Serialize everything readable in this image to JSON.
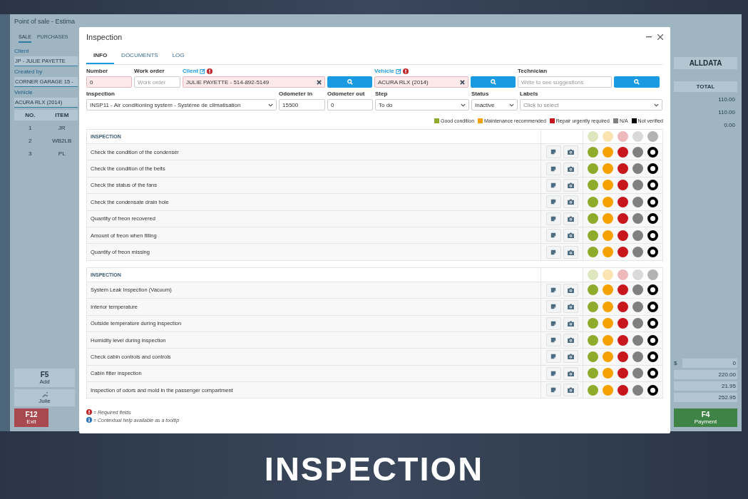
{
  "background_app": {
    "title": "Point of sale - Estima",
    "tabs": [
      {
        "label": "SALE",
        "selected": true
      },
      {
        "label": "PURCHASES",
        "selected": false
      }
    ],
    "fields": [
      {
        "label": "Client",
        "value": "JP - JULIE PAYETTE"
      },
      {
        "label": "Created by",
        "value": "CORNER GARAGE 15 -"
      },
      {
        "label": "Vehicle",
        "value": "ACURA RLX (2014)"
      }
    ],
    "table": {
      "columns": [
        "NO.",
        "ITEM"
      ],
      "rows": [
        [
          "1",
          "JR"
        ],
        [
          "2",
          "WB2LB"
        ],
        [
          "3",
          "PL"
        ]
      ]
    },
    "left_buttons": [
      {
        "key": "F5",
        "label": "Add"
      },
      {
        "label": "Julie"
      }
    ],
    "exit_button": {
      "key": "F12",
      "label": "Exit"
    },
    "right_logo": "ALLDATA",
    "total_column": "TOTAL",
    "totals": [
      "110.00",
      "110.00",
      "0.00"
    ],
    "discount": {
      "symbol": "$",
      "value": "0"
    },
    "summary": [
      "220.00",
      "21.95",
      "252.95"
    ],
    "payment_button": {
      "key": "F4",
      "label": "Payment"
    }
  },
  "dialog": {
    "title": "Inspection",
    "tabs": [
      {
        "label": "INFO",
        "selected": true
      },
      {
        "label": "DOCUMENTS",
        "selected": false
      },
      {
        "label": "LOG",
        "selected": false
      }
    ],
    "row_1": [
      {
        "kind": "text",
        "label": "Number",
        "value": "0",
        "invalid": true
      },
      {
        "kind": "text",
        "label": "Work order",
        "placeholder": "Work order",
        "invalid": false
      },
      {
        "kind": "lookup",
        "label": "Client",
        "value": "JULIE PAYETTE - 514-892-5149",
        "invalid": true,
        "required": true
      },
      {
        "kind": "search_button"
      },
      {
        "kind": "lookup",
        "label": "Vehicle",
        "value": "ACURA RLX (2014)",
        "invalid": true,
        "required": true
      },
      {
        "kind": "search_button"
      },
      {
        "kind": "text",
        "label": "Technician",
        "placeholder": "Write to see suggestions",
        "invalid": false
      },
      {
        "kind": "search_button"
      }
    ],
    "row_2": [
      {
        "kind": "select",
        "label": "Inspection",
        "value": "INSP11 - Air conditioning system - Système de climatisation"
      },
      {
        "kind": "text",
        "label": "Odometer in",
        "value": "15500",
        "invalid": false
      },
      {
        "kind": "text",
        "label": "Odometer out",
        "value": "0",
        "invalid": false
      },
      {
        "kind": "select",
        "label": "Step",
        "value": "To do"
      },
      {
        "kind": "select",
        "label": "Status",
        "value": "Inactive"
      },
      {
        "kind": "select",
        "label": "Labels",
        "placeholder": "Click to select"
      }
    ],
    "legend": [
      {
        "label": "Good condition",
        "color": "#8fab2c"
      },
      {
        "label": "Maintenance recommended",
        "color": "#f5a200"
      },
      {
        "label": "Repair urgently required",
        "color": "#c8161d"
      },
      {
        "label": "N/A",
        "color": "#808080"
      },
      {
        "label": "Not verified",
        "color": "#000000"
      }
    ],
    "sections": [
      {
        "title": "INSPECTION",
        "items": [
          "Check the condition of the condenser",
          "Check the condition of the belts",
          "Check the status of the fans",
          "Check the condensate drain hole",
          "Quantity of freon recovered",
          "Amount of freon when filling",
          "Quantity of freon missing"
        ]
      },
      {
        "title": "INSPECTION",
        "items": [
          "System Leak Inspection (Vacuum)",
          "Interior temperature",
          "Outside temperature during inspection",
          "Humidity level during inspection",
          "Check cabin controls and controls",
          "Cabin filter inspection",
          "Inspection of odors and mold in the passenger compartment"
        ]
      }
    ],
    "notes": [
      {
        "kind": "required",
        "text": "= Required fields"
      },
      {
        "kind": "help",
        "text": "= Contextual help available as a tooltip"
      }
    ]
  },
  "banner": "INSPECTION"
}
